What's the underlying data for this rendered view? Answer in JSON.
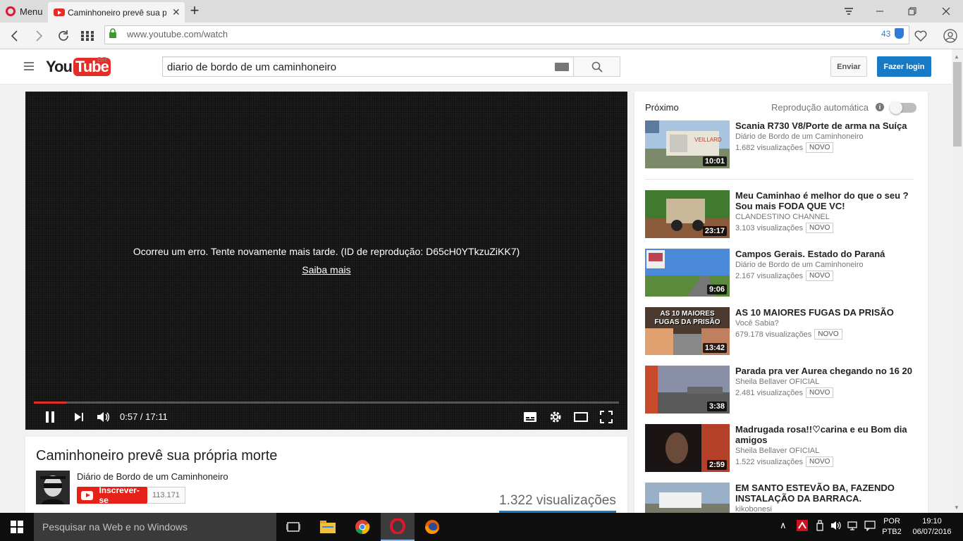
{
  "browser": {
    "menu_label": "Menu",
    "tab_title": "Caminhoneiro prevê sua p",
    "url": "www.youtube.com/watch",
    "blocked_count": "43",
    "colors": {
      "opera_red": "#e0172c",
      "accent_blue": "#2f7ad8"
    }
  },
  "youtube": {
    "logo_you": "You",
    "logo_tube": "Tube",
    "country": "BR",
    "search_value": "diario de bordo de um caminhoneiro",
    "upload_label": "Enviar",
    "login_label": "Fazer login"
  },
  "player": {
    "error_message": "Ocorreu um erro. Tente novamente mais tarde. (ID de reprodução: D65cH0YTkzuZiKK7)",
    "learn_more": "Saiba mais",
    "time": "0:57 / 17:11",
    "progress_fraction": 0.055
  },
  "video": {
    "title": "Caminhoneiro prevê sua própria morte",
    "channel": "Diário de Bordo de um Caminhoneiro",
    "subscribe_label": "Inscrever-se",
    "subscriber_count": "113.171",
    "views": "1.322 visualizações"
  },
  "sidebar": {
    "next_label": "Próximo",
    "autoplay_label": "Reprodução automática",
    "new_badge": "NOVO",
    "items": [
      {
        "title": "Scania R730 V8/Porte de arma na Suíça",
        "channel": "Diário de Bordo de um Caminhoneiro",
        "views": "1.682 visualizações",
        "duration": "10:01"
      },
      {
        "title": "Meu Caminhao é melhor do que o seu ?Sou mais FODA QUE VC!",
        "channel": "CLANDESTINO CHANNEL",
        "views": "3.103 visualizações",
        "duration": "23:17"
      },
      {
        "title": "Campos Gerais. Estado do Paraná",
        "channel": "Diário de Bordo de um Caminhoneiro",
        "views": "2.167 visualizações",
        "duration": "9:06"
      },
      {
        "title": "AS 10 MAIORES FUGAS DA PRISÃO",
        "channel": "Você Sabia?",
        "views": "679.178 visualizações",
        "duration": "13:42",
        "thumb_text": "AS 10 MAIORES FUGAS DA PRISÃO"
      },
      {
        "title": "Parada pra ver Aurea chegando no 16 20",
        "channel": "Sheila Bellaver OFICIAL",
        "views": "2.481 visualizações",
        "duration": "3:38"
      },
      {
        "title": "Madrugada rosa!!♡carina e eu Bom dia amigos",
        "channel": "Sheila Bellaver OFICIAL",
        "views": "1.522 visualizações",
        "duration": "2:59"
      },
      {
        "title": "EM SANTO ESTEVÃO BA, FAZENDO INSTALAÇÃO DA BARRACA.",
        "channel": "kikobonesi"
      }
    ]
  },
  "taskbar": {
    "search_placeholder": "Pesquisar na Web e no Windows",
    "lang_1": "POR",
    "lang_2": "PTB2",
    "time": "19:10",
    "date": "06/07/2016"
  }
}
